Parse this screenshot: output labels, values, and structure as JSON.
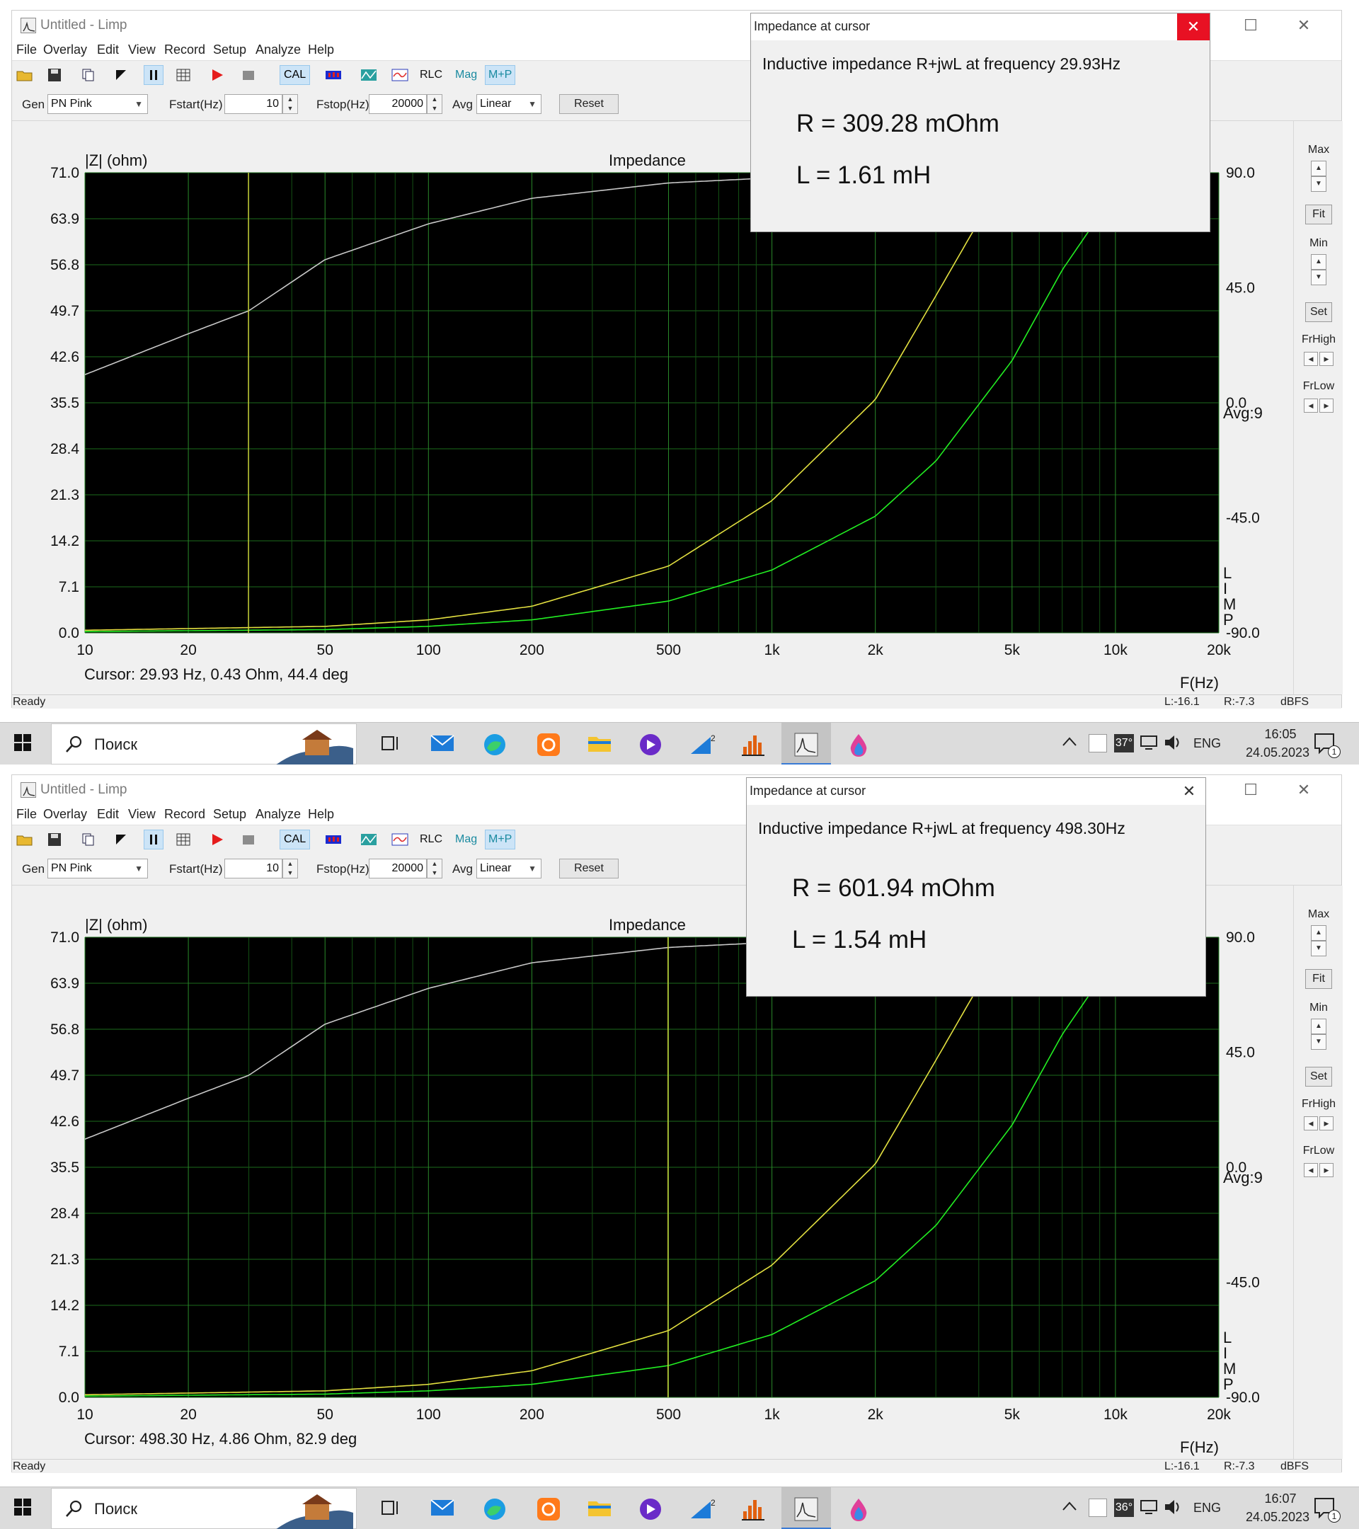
{
  "app": {
    "title": "Untitled - Limp",
    "menu": [
      "File",
      "Overlay",
      "Edit",
      "View",
      "Record",
      "Setup",
      "Analyze",
      "Help"
    ],
    "toolbar": {
      "cal": "CAL",
      "rlc": "RLC",
      "mag": "Mag",
      "mp": "M+P"
    },
    "controls": {
      "gen_label": "Gen",
      "gen_value": "PN Pink",
      "fstart_label": "Fstart(Hz)",
      "fstart_value": "10",
      "fstop_label": "Fstop(Hz)",
      "fstop_value": "20000",
      "avg_label": "Avg",
      "avg_value": "Linear",
      "reset_label": "Reset"
    },
    "right_panel": {
      "max": "Max",
      "fit": "Fit",
      "min": "Min",
      "set": "Set",
      "frhigh": "FrHigh",
      "frlow": "FrLow"
    },
    "status": {
      "ready": "Ready",
      "left": "L:-16.1",
      "right": "R:-7.3",
      "unit": "dBFS"
    }
  },
  "chart_data": [
    {
      "type": "line",
      "title": "Impedance",
      "ylabel": "|Z| (ohm)",
      "xlabel": "F(Hz)",
      "y_ticks": [
        "71.0",
        "63.9",
        "56.8",
        "49.7",
        "42.6",
        "35.5",
        "28.4",
        "21.3",
        "14.2",
        "7.1",
        "0.0"
      ],
      "y2_ticks": [
        "90.0",
        "45.0",
        "0.0",
        "-45.0",
        "-90.0"
      ],
      "x_ticks": [
        "10",
        "20",
        "50",
        "100",
        "200",
        "500",
        "1k",
        "2k",
        "5k",
        "10k",
        "20k"
      ],
      "x_tick_values": [
        10,
        20,
        50,
        100,
        200,
        500,
        1000,
        2000,
        5000,
        10000,
        20000
      ],
      "ylim": [
        0,
        71
      ],
      "y2lim": [
        -90,
        90
      ],
      "x_scale": "log",
      "xlim": [
        10,
        20000
      ],
      "avg_text": "Avg:9",
      "side_text": [
        "L",
        "I",
        "M",
        "P"
      ],
      "cursor_text": "Cursor: 29.93 Hz, 0.43 Ohm, 44.4 deg",
      "cursor_x": 29.93,
      "series": [
        {
          "color": "#e3e040",
          "x": [
            10,
            50,
            100,
            200,
            500,
            1000,
            2000,
            3000,
            4000,
            5000
          ],
          "values": [
            0.4,
            1.0,
            2.0,
            4.1,
            10.3,
            20.4,
            36.0,
            52.0,
            63.5,
            73.0
          ]
        },
        {
          "color": "#22ee22",
          "x": [
            10,
            50,
            100,
            200,
            500,
            1000,
            2000,
            3000,
            5000,
            7000,
            10000
          ],
          "values": [
            0.2,
            0.5,
            1.0,
            2.0,
            4.9,
            9.7,
            18.0,
            26.5,
            42.0,
            56.0,
            68.0
          ]
        },
        {
          "color": "#c8c8c8",
          "axis": "y2",
          "x": [
            10,
            20,
            30,
            50,
            100,
            200,
            500,
            1000,
            2000
          ],
          "values": [
            11,
            27,
            36,
            56,
            70,
            80,
            86,
            88,
            88
          ]
        }
      ]
    },
    {
      "type": "line",
      "title": "Impedance",
      "ylabel": "|Z| (ohm)",
      "xlabel": "F(Hz)",
      "y_ticks": [
        "71.0",
        "63.9",
        "56.8",
        "49.7",
        "42.6",
        "35.5",
        "28.4",
        "21.3",
        "14.2",
        "7.1",
        "0.0"
      ],
      "y2_ticks": [
        "90.0",
        "45.0",
        "0.0",
        "-45.0",
        "-90.0"
      ],
      "x_ticks": [
        "10",
        "20",
        "50",
        "100",
        "200",
        "500",
        "1k",
        "2k",
        "5k",
        "10k",
        "20k"
      ],
      "x_tick_values": [
        10,
        20,
        50,
        100,
        200,
        500,
        1000,
        2000,
        5000,
        10000,
        20000
      ],
      "ylim": [
        0,
        71
      ],
      "y2lim": [
        -90,
        90
      ],
      "x_scale": "log",
      "xlim": [
        10,
        20000
      ],
      "avg_text": "Avg:9",
      "side_text": [
        "L",
        "I",
        "M",
        "P"
      ],
      "cursor_text": "Cursor: 498.30 Hz, 4.86 Ohm, 82.9 deg",
      "cursor_x": 498.3,
      "series": [
        {
          "color": "#e3e040",
          "x": [
            10,
            50,
            100,
            200,
            500,
            1000,
            2000,
            3000,
            4000,
            5000
          ],
          "values": [
            0.4,
            1.0,
            2.0,
            4.1,
            10.3,
            20.4,
            36.0,
            52.0,
            63.5,
            73.0
          ]
        },
        {
          "color": "#22ee22",
          "x": [
            10,
            50,
            100,
            200,
            500,
            1000,
            2000,
            3000,
            5000,
            7000,
            10000
          ],
          "values": [
            0.2,
            0.5,
            1.0,
            2.0,
            4.9,
            9.7,
            18.0,
            26.5,
            42.0,
            56.0,
            68.0
          ]
        },
        {
          "color": "#c8c8c8",
          "axis": "y2",
          "x": [
            10,
            20,
            30,
            50,
            100,
            200,
            500,
            1000,
            2000
          ],
          "values": [
            11,
            27,
            36,
            56,
            70,
            80,
            86,
            88,
            88
          ]
        }
      ]
    }
  ],
  "dialogs": [
    {
      "title": "Impedance at cursor",
      "desc": "Inductive impedance R+jwL at frequency 29.93Hz",
      "r": "R = 309.28 mOhm",
      "l": "L = 1.61 mH"
    },
    {
      "title": "Impedance at cursor",
      "desc": "Inductive impedance R+jwL at frequency 498.30Hz",
      "r": "R = 601.94 mOhm",
      "l": "L = 1.54 mH"
    }
  ],
  "taskbars": [
    {
      "search": "Поиск",
      "temp": "37°",
      "lang": "ENG",
      "time": "16:05",
      "date": "24.05.2023",
      "notif": "1"
    },
    {
      "search": "Поиск",
      "temp": "36°",
      "lang": "ENG",
      "time": "16:07",
      "date": "24.05.2023",
      "notif": "1"
    }
  ]
}
